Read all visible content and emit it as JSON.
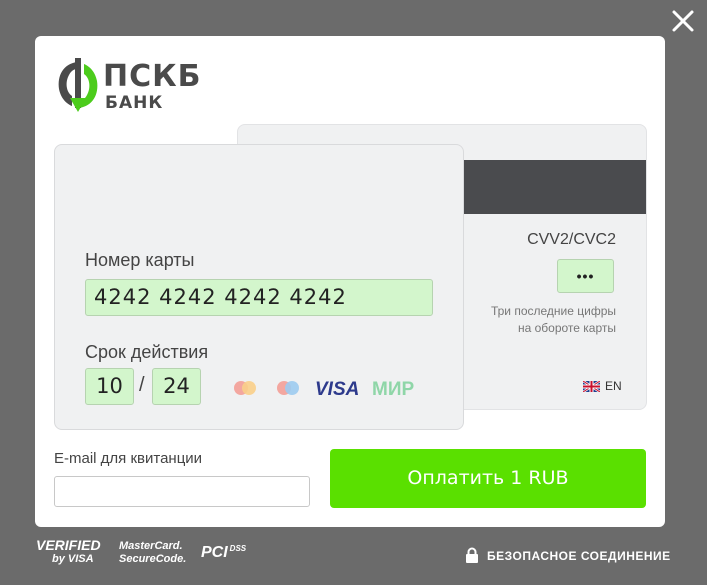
{
  "brand": {
    "name": "ПСКБ",
    "sub": "БАНК"
  },
  "card_front": {
    "number_label": "Номер карты",
    "number_value": "4242 4242 4242 4242",
    "expiry_label": "Срок действия",
    "expiry_month": "10",
    "expiry_sep": "/",
    "expiry_year": "24",
    "brands": [
      "Maestro",
      "MasterCard",
      "VISA",
      "МИР"
    ]
  },
  "card_back": {
    "cvv_label": "CVV2/CVC2",
    "cvv_value": "•••",
    "cvv_hint_line1": "Три последние цифры",
    "cvv_hint_line2": "на обороте карты"
  },
  "language": {
    "code": "EN"
  },
  "email": {
    "label": "E-mail для квитанции",
    "value": ""
  },
  "pay_button": {
    "label": "Оплатить 1 RUB"
  },
  "footer": {
    "verified_by": "VERIFIED",
    "verified_by_sub": "by VISA",
    "mc_secure_1": "MasterCard.",
    "mc_secure_2": "SecureCode.",
    "pci": "PCI",
    "pci_sub": "DSS",
    "secure_text": "БЕЗОПАСНОЕ СОЕДИНЕНИЕ"
  },
  "colors": {
    "accent": "#5ae000",
    "field_bg": "#d3f6cc",
    "overlay": "#6b6b6b",
    "stripe": "#4a4b4e"
  }
}
